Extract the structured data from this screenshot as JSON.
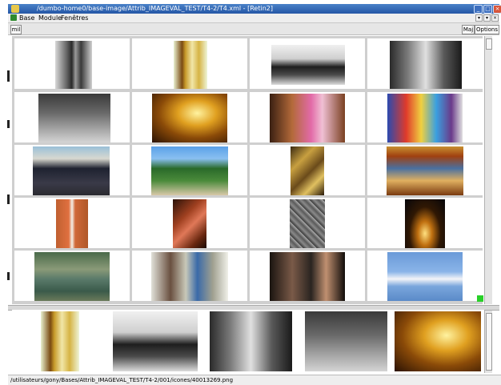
{
  "window": {
    "title": "/dumbo-home0/base-image/Attrib_IMAGEVAL_TEST/T4-2/T4.xml - [Retin2]",
    "controls": [
      "_",
      "□",
      "×"
    ]
  },
  "menu": {
    "items": [
      "Base",
      "Module",
      "Fenêtres"
    ],
    "right_controls": [
      "▾",
      "▾",
      "×"
    ]
  },
  "toolbar": {
    "left_button": "mil",
    "maj_button": "Maj",
    "options_button": "Options"
  },
  "grid": {
    "images": [
      {
        "icon": "men-in-coats-photo"
      },
      {
        "icon": "beer-bottle-glass-photo"
      },
      {
        "icon": "vintage-car-photo"
      },
      {
        "icon": "city-street-bw-photo"
      },
      {
        "icon": "forest-car-bw-photo"
      },
      {
        "icon": "golden-sunset-clouds-photo"
      },
      {
        "icon": "mother-child-photo"
      },
      {
        "icon": "street-art-crowd-photo"
      },
      {
        "icon": "officials-crowd-photo"
      },
      {
        "icon": "garden-path-photo"
      },
      {
        "icon": "market-stall-photo"
      },
      {
        "icon": "ornate-ceiling-fresco-photo"
      },
      {
        "icon": "tennis-player-photo"
      },
      {
        "icon": "hands-photo"
      },
      {
        "icon": "stone-wall-texture-photo"
      },
      {
        "icon": "eiffel-tower-night-photo"
      },
      {
        "icon": "flooded-village-photo"
      },
      {
        "icon": "computer-lab-photo"
      },
      {
        "icon": "people-party-photo"
      },
      {
        "icon": "concorde-jet-photo"
      }
    ]
  },
  "strip": {
    "images": [
      {
        "icon": "beer-bottle-glass-photo"
      },
      {
        "icon": "vintage-car-photo"
      },
      {
        "icon": "city-street-bw-photo"
      },
      {
        "icon": "forest-car-bw-photo"
      },
      {
        "icon": "golden-sunset-clouds-photo"
      }
    ]
  },
  "status": {
    "path": "/utilisateurs/gony/Bases/Attrib_IMAGEVAL_TEST/T4-2/001/icones/40013269.png"
  },
  "colors": {
    "title_bar": "#2f62b3",
    "grid_background": "#cfcfcf",
    "status_indicator": "#28d028"
  }
}
